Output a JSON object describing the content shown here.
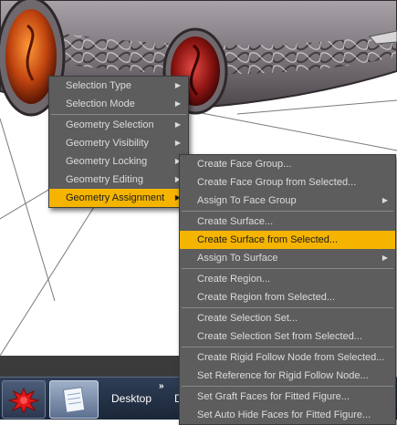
{
  "context_menu": {
    "items": [
      {
        "label": "Selection Type",
        "submenu": true
      },
      {
        "label": "Selection Mode",
        "submenu": true
      },
      {
        "label": "Geometry Selection",
        "submenu": true
      },
      {
        "label": "Geometry Visibility",
        "submenu": true
      },
      {
        "label": "Geometry Locking",
        "submenu": true
      },
      {
        "label": "Geometry Editing",
        "submenu": true
      },
      {
        "label": "Geometry Assignment",
        "submenu": true,
        "active": true
      }
    ]
  },
  "submenu": {
    "items": [
      {
        "label": "Create Face Group..."
      },
      {
        "label": "Create Face Group from Selected..."
      },
      {
        "label": "Assign To Face Group",
        "submenu": true
      },
      {
        "label": "Create Surface..."
      },
      {
        "label": "Create Surface from Selected...",
        "highlighted": true
      },
      {
        "label": "Assign To Surface",
        "submenu": true
      },
      {
        "label": "Create Region..."
      },
      {
        "label": "Create Region from Selected..."
      },
      {
        "label": "Create Selection Set..."
      },
      {
        "label": "Create Selection Set from Selected..."
      },
      {
        "label": "Create Rigid Follow Node from Selected..."
      },
      {
        "label": "Set Reference for Rigid Follow Node..."
      },
      {
        "label": "Set Graft Faces for Fitted Figure..."
      },
      {
        "label": "Set Auto Hide Faces for Fitted Figure..."
      }
    ]
  },
  "taskbar": {
    "desktop_label": "Desktop",
    "overflow_chevron": "»",
    "clipped_label": "D"
  },
  "icons": {
    "submenu_arrow": "▶",
    "app1_icon": "red-splat-icon",
    "app2_icon": "notepad-icon"
  },
  "colors": {
    "menu_bg": "#5d5d5d",
    "menu_text": "#dcdcdc",
    "highlight": "#f4b400",
    "taskbar": "#1b2638"
  }
}
